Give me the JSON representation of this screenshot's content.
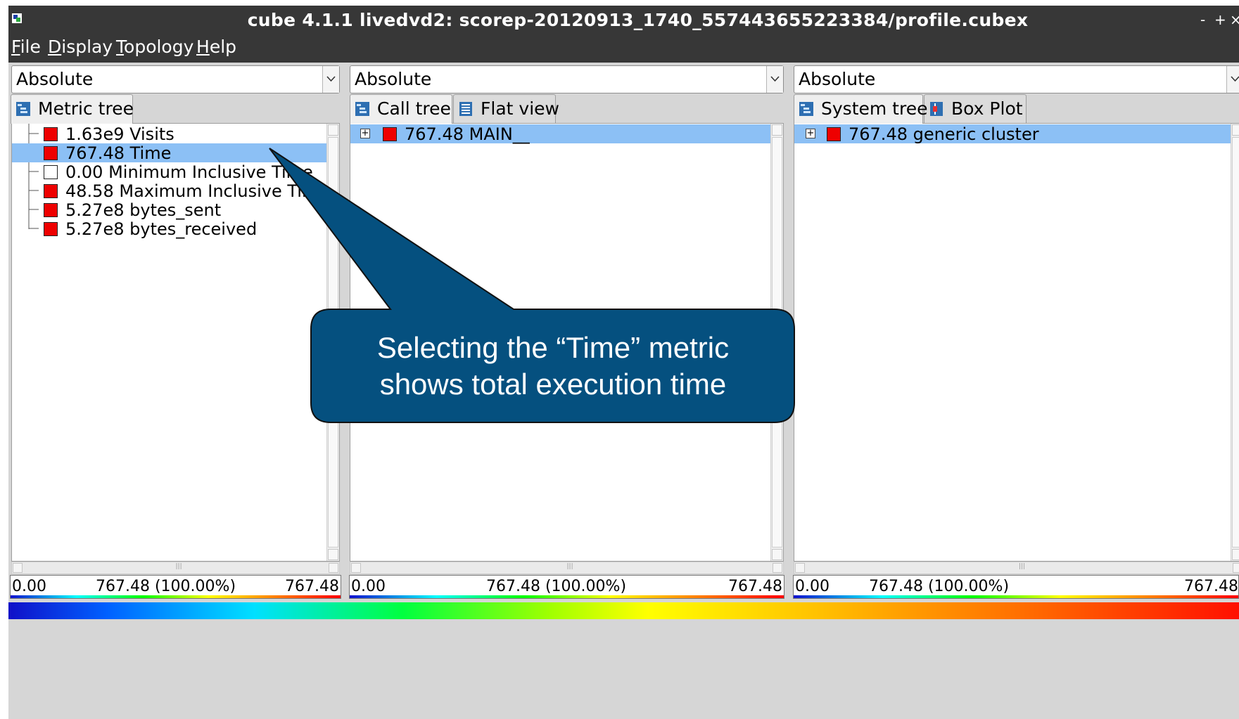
{
  "window": {
    "title": "cube 4.1.1 livedvd2: scorep-20120913_1740_557443655223384/profile.cubex",
    "controls": {
      "minimize": "-",
      "maximize": "+",
      "close": "×"
    }
  },
  "menu": [
    {
      "mnemonic": "F",
      "rest": "ile"
    },
    {
      "mnemonic": "D",
      "rest": "isplay"
    },
    {
      "mnemonic": "T",
      "rest": "opology"
    },
    {
      "mnemonic": "H",
      "rest": "elp"
    }
  ],
  "selectors": [
    {
      "value": "Absolute"
    },
    {
      "value": "Absolute"
    },
    {
      "value": "Absolute"
    }
  ],
  "metric_panel": {
    "tabs": [
      {
        "label": "Metric tree",
        "active": true
      }
    ],
    "rows": [
      {
        "value": "1.63e9",
        "label": "Visits",
        "color": "#ee0000",
        "selected": false
      },
      {
        "value": "767.48",
        "label": "Time",
        "color": "#ee0000",
        "selected": true
      },
      {
        "value": "0.00",
        "label": "Minimum Inclusive Time",
        "color": "#ffffff",
        "selected": false
      },
      {
        "value": "48.58",
        "label": "Maximum Inclusive Time",
        "color": "#ee0000",
        "selected": false
      },
      {
        "value": "5.27e8",
        "label": "bytes_sent",
        "color": "#ee0000",
        "selected": false
      },
      {
        "value": "5.27e8",
        "label": "bytes_received",
        "color": "#ee0000",
        "selected": false
      }
    ],
    "range": {
      "min": "0.00",
      "mid": "767.48 (100.00%)",
      "max": "767.48"
    }
  },
  "call_panel": {
    "tabs": [
      {
        "label": "Call tree",
        "active": true
      },
      {
        "label": "Flat view",
        "active": false
      }
    ],
    "rows": [
      {
        "value": "767.48",
        "label": "MAIN__",
        "color": "#ee0000",
        "selected": true,
        "expander": "+"
      }
    ],
    "range": {
      "min": "0.00",
      "mid": "767.48 (100.00%)",
      "max": "767.48"
    }
  },
  "system_panel": {
    "tabs": [
      {
        "label": "System tree",
        "active": true
      },
      {
        "label": "Box Plot",
        "active": false
      }
    ],
    "rows": [
      {
        "value": "767.48",
        "label": "generic cluster",
        "color": "#ee0000",
        "selected": true,
        "expander": "+"
      }
    ],
    "range": {
      "min": "0.00",
      "mid": "767.48 (100.00%)",
      "max": "767.48"
    }
  },
  "callout": {
    "line1": "Selecting the “Time” metric",
    "line2": "shows total execution time",
    "fill": "#05507f"
  },
  "icons": {
    "tree_tab": "tree-icon",
    "flat_tab": "list-icon",
    "boxplot_tab": "boxplot-icon",
    "dropdown": "chevron-down-icon",
    "app": "cube-app-icon"
  }
}
